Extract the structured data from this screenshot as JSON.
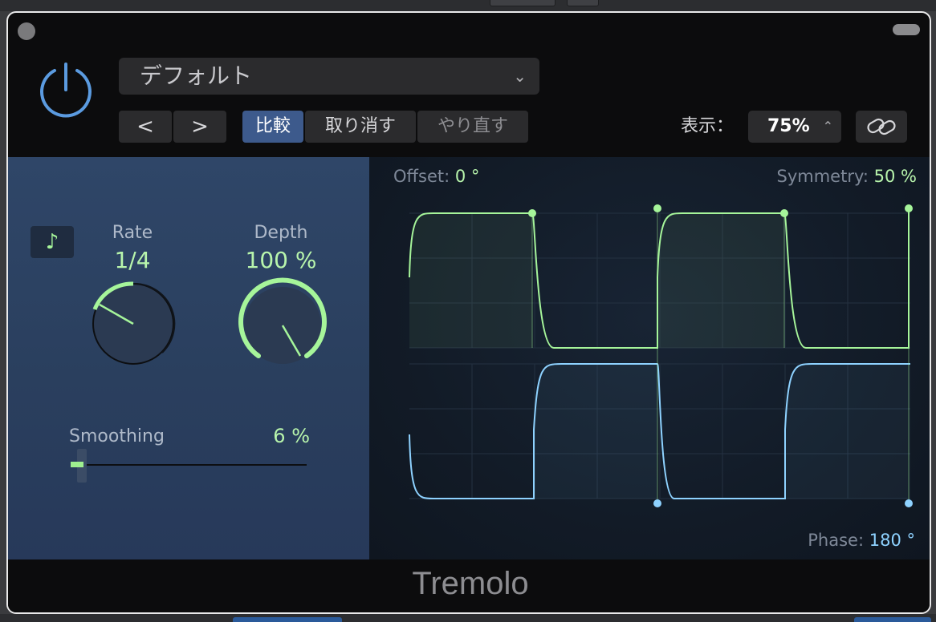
{
  "preset": {
    "name": "デフォルト"
  },
  "toolbar": {
    "prev": "<",
    "next": ">",
    "compare": "比較",
    "undo": "取り消す",
    "redo": "やり直す",
    "view_label": "表示：",
    "zoom": "75%"
  },
  "controls": {
    "rate": {
      "label": "Rate",
      "value": "1/4"
    },
    "depth": {
      "label": "Depth",
      "value": "100 %",
      "fill_fraction": 1.0
    },
    "smoothing": {
      "label": "Smoothing",
      "value": "6 %",
      "fraction": 0.06
    },
    "sync_icon": "♪"
  },
  "lfo": {
    "offset_label": "Offset:",
    "offset_value": "0 °",
    "symmetry_label": "Symmetry:",
    "symmetry_value": "50 %",
    "phase_label": "Phase:",
    "phase_value": "180 °"
  },
  "footer": {
    "title": "Tremolo"
  },
  "colors": {
    "green_wave": "#a6f59a",
    "blue_wave": "#8ed2ff",
    "power_blue": "#5b9be0"
  }
}
